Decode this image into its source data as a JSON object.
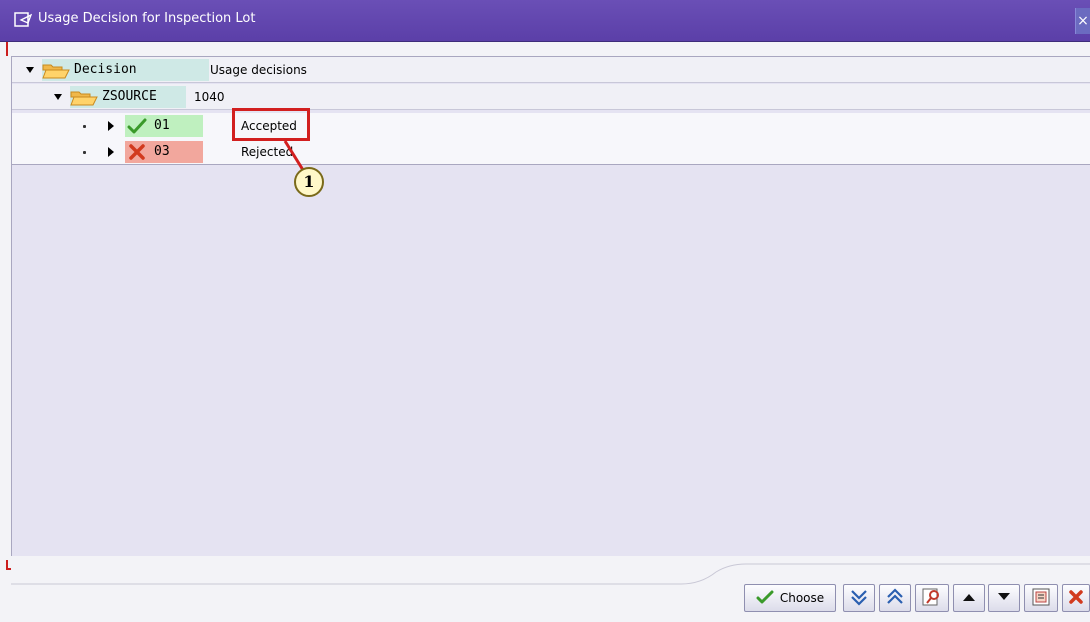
{
  "window": {
    "title": "Usage Decision for Inspection Lot",
    "close_glyph": "×"
  },
  "tree": {
    "header": {
      "node": "Decision",
      "text": "Usage decisions"
    },
    "group": {
      "node": "ZSOURCE",
      "text": "1040"
    },
    "items": [
      {
        "code": "01",
        "text": "Accepted",
        "icon": "check-icon",
        "color": "#bff0bf"
      },
      {
        "code": "03",
        "text": "Rejected",
        "icon": "x-icon",
        "color": "#f2a79d"
      }
    ]
  },
  "callout": {
    "number": "1"
  },
  "toolbar": {
    "choose_label": "Choose",
    "buttons": [
      "expand-all-icon",
      "collapse-all-icon",
      "find-icon",
      "scroll-up-icon",
      "scroll-down-icon",
      "details-icon",
      "cancel-icon"
    ]
  },
  "colors": {
    "titlebar": "#5b3fa8",
    "panel": "#e5e3f2",
    "accent_red": "#d21f1f"
  }
}
